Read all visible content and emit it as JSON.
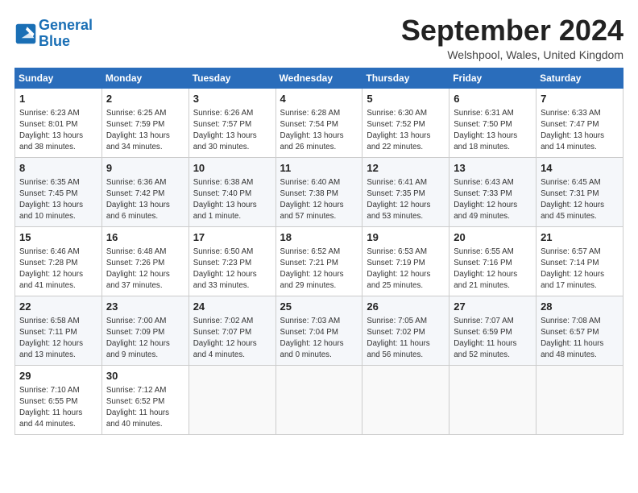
{
  "header": {
    "logo_line1": "General",
    "logo_line2": "Blue",
    "month": "September 2024",
    "location": "Welshpool, Wales, United Kingdom"
  },
  "weekdays": [
    "Sunday",
    "Monday",
    "Tuesday",
    "Wednesday",
    "Thursday",
    "Friday",
    "Saturday"
  ],
  "weeks": [
    [
      {
        "day": "1",
        "info": "Sunrise: 6:23 AM\nSunset: 8:01 PM\nDaylight: 13 hours\nand 38 minutes."
      },
      {
        "day": "2",
        "info": "Sunrise: 6:25 AM\nSunset: 7:59 PM\nDaylight: 13 hours\nand 34 minutes."
      },
      {
        "day": "3",
        "info": "Sunrise: 6:26 AM\nSunset: 7:57 PM\nDaylight: 13 hours\nand 30 minutes."
      },
      {
        "day": "4",
        "info": "Sunrise: 6:28 AM\nSunset: 7:54 PM\nDaylight: 13 hours\nand 26 minutes."
      },
      {
        "day": "5",
        "info": "Sunrise: 6:30 AM\nSunset: 7:52 PM\nDaylight: 13 hours\nand 22 minutes."
      },
      {
        "day": "6",
        "info": "Sunrise: 6:31 AM\nSunset: 7:50 PM\nDaylight: 13 hours\nand 18 minutes."
      },
      {
        "day": "7",
        "info": "Sunrise: 6:33 AM\nSunset: 7:47 PM\nDaylight: 13 hours\nand 14 minutes."
      }
    ],
    [
      {
        "day": "8",
        "info": "Sunrise: 6:35 AM\nSunset: 7:45 PM\nDaylight: 13 hours\nand 10 minutes."
      },
      {
        "day": "9",
        "info": "Sunrise: 6:36 AM\nSunset: 7:42 PM\nDaylight: 13 hours\nand 6 minutes."
      },
      {
        "day": "10",
        "info": "Sunrise: 6:38 AM\nSunset: 7:40 PM\nDaylight: 13 hours\nand 1 minute."
      },
      {
        "day": "11",
        "info": "Sunrise: 6:40 AM\nSunset: 7:38 PM\nDaylight: 12 hours\nand 57 minutes."
      },
      {
        "day": "12",
        "info": "Sunrise: 6:41 AM\nSunset: 7:35 PM\nDaylight: 12 hours\nand 53 minutes."
      },
      {
        "day": "13",
        "info": "Sunrise: 6:43 AM\nSunset: 7:33 PM\nDaylight: 12 hours\nand 49 minutes."
      },
      {
        "day": "14",
        "info": "Sunrise: 6:45 AM\nSunset: 7:31 PM\nDaylight: 12 hours\nand 45 minutes."
      }
    ],
    [
      {
        "day": "15",
        "info": "Sunrise: 6:46 AM\nSunset: 7:28 PM\nDaylight: 12 hours\nand 41 minutes."
      },
      {
        "day": "16",
        "info": "Sunrise: 6:48 AM\nSunset: 7:26 PM\nDaylight: 12 hours\nand 37 minutes."
      },
      {
        "day": "17",
        "info": "Sunrise: 6:50 AM\nSunset: 7:23 PM\nDaylight: 12 hours\nand 33 minutes."
      },
      {
        "day": "18",
        "info": "Sunrise: 6:52 AM\nSunset: 7:21 PM\nDaylight: 12 hours\nand 29 minutes."
      },
      {
        "day": "19",
        "info": "Sunrise: 6:53 AM\nSunset: 7:19 PM\nDaylight: 12 hours\nand 25 minutes."
      },
      {
        "day": "20",
        "info": "Sunrise: 6:55 AM\nSunset: 7:16 PM\nDaylight: 12 hours\nand 21 minutes."
      },
      {
        "day": "21",
        "info": "Sunrise: 6:57 AM\nSunset: 7:14 PM\nDaylight: 12 hours\nand 17 minutes."
      }
    ],
    [
      {
        "day": "22",
        "info": "Sunrise: 6:58 AM\nSunset: 7:11 PM\nDaylight: 12 hours\nand 13 minutes."
      },
      {
        "day": "23",
        "info": "Sunrise: 7:00 AM\nSunset: 7:09 PM\nDaylight: 12 hours\nand 9 minutes."
      },
      {
        "day": "24",
        "info": "Sunrise: 7:02 AM\nSunset: 7:07 PM\nDaylight: 12 hours\nand 4 minutes."
      },
      {
        "day": "25",
        "info": "Sunrise: 7:03 AM\nSunset: 7:04 PM\nDaylight: 12 hours\nand 0 minutes."
      },
      {
        "day": "26",
        "info": "Sunrise: 7:05 AM\nSunset: 7:02 PM\nDaylight: 11 hours\nand 56 minutes."
      },
      {
        "day": "27",
        "info": "Sunrise: 7:07 AM\nSunset: 6:59 PM\nDaylight: 11 hours\nand 52 minutes."
      },
      {
        "day": "28",
        "info": "Sunrise: 7:08 AM\nSunset: 6:57 PM\nDaylight: 11 hours\nand 48 minutes."
      }
    ],
    [
      {
        "day": "29",
        "info": "Sunrise: 7:10 AM\nSunset: 6:55 PM\nDaylight: 11 hours\nand 44 minutes."
      },
      {
        "day": "30",
        "info": "Sunrise: 7:12 AM\nSunset: 6:52 PM\nDaylight: 11 hours\nand 40 minutes."
      },
      {
        "day": "",
        "info": ""
      },
      {
        "day": "",
        "info": ""
      },
      {
        "day": "",
        "info": ""
      },
      {
        "day": "",
        "info": ""
      },
      {
        "day": "",
        "info": ""
      }
    ]
  ]
}
